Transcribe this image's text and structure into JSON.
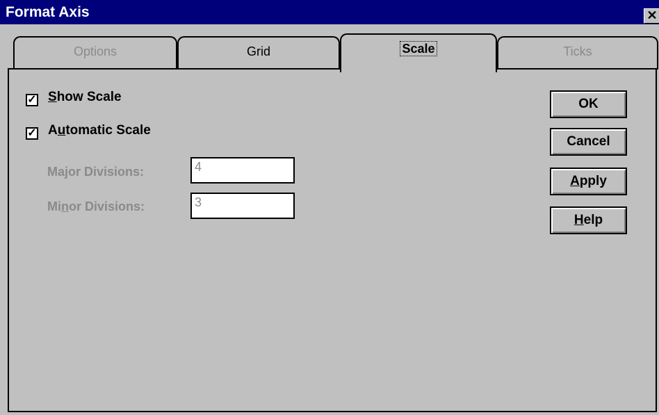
{
  "window": {
    "title": "Format Axis",
    "close_glyph": "✕"
  },
  "tabs": [
    {
      "label": "Options",
      "state": "disabled"
    },
    {
      "label": "Grid",
      "state": "normal"
    },
    {
      "label": "Scale",
      "state": "active"
    },
    {
      "label": "Ticks",
      "state": "disabled"
    }
  ],
  "options": {
    "show_scale": {
      "checked": true,
      "mark": "✓",
      "label_underlined": "S",
      "label_rest": "how Scale"
    },
    "automatic_scale": {
      "checked": true,
      "mark": "✓",
      "label_prefix": "A",
      "label_underlined": "u",
      "label_rest": "tomatic Scale"
    }
  },
  "fields": {
    "major": {
      "label": "Major Divisions:",
      "value": "4",
      "disabled": true
    },
    "minor": {
      "label_prefix": "Mi",
      "label_underlined": "n",
      "label_rest": "or Divisions:",
      "value": "3",
      "disabled": true
    }
  },
  "buttons": {
    "ok": "OK",
    "cancel": "Cancel",
    "apply_underlined": "A",
    "apply_rest": "pply",
    "help_underlined": "H",
    "help_rest": "elp"
  }
}
